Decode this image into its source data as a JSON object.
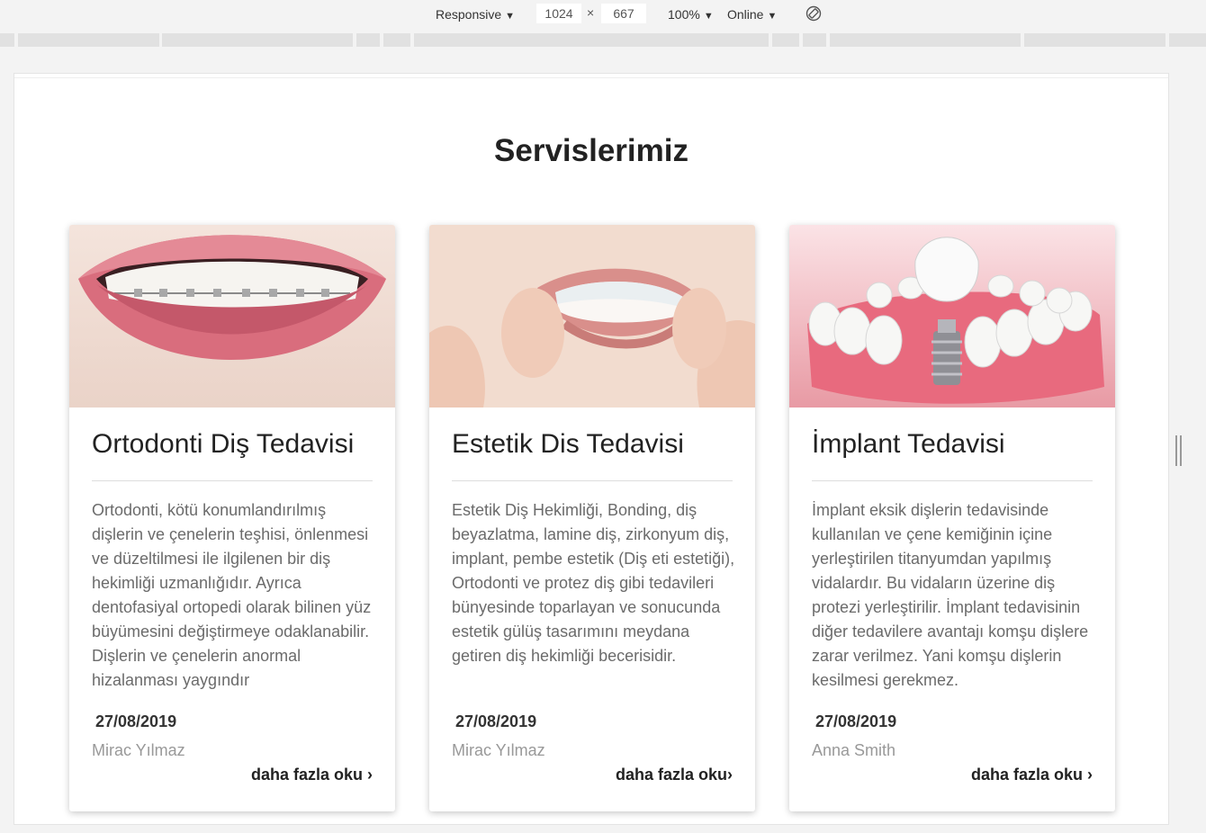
{
  "devtools": {
    "device_select": "Responsive",
    "width_value": "1024",
    "height_value": "667",
    "times_sign": "×",
    "zoom_select": "100%",
    "network_select": "Online",
    "caret": "▼",
    "rotate_icon": "rotate-icon"
  },
  "section": {
    "title": "Servislerimiz"
  },
  "cards": [
    {
      "title": "Ortodonti Diş Tedavisi",
      "text": "Ortodonti, kötü konumlandırılmış dişlerin ve çenelerin teşhisi, önlenmesi ve düzeltilmesi ile ilgilenen bir diş hekimliği uzmanlığıdır. Ayrıca dentofasiyal ortopedi olarak bilinen yüz büyümesini değiştirmeye odaklanabilir. Dişlerin ve çenelerin anormal hizalanması yaygındır",
      "date": "27/08/2019",
      "author": "Mirac Yılmaz",
      "more": "daha fazla oku",
      "image": "braces-smile-photo"
    },
    {
      "title": "Estetik Dis Tedavisi",
      "text": "Estetik Diş Hekimliği, Bonding, diş beyazlatma, lamine diş, zirkonyum diş, implant, pembe estetik (Diş eti estetiği), Ortodonti ve protez diş gibi tedavileri bünyesinde toparlayan ve sonucunda estetik gülüş tasarımını meydana getiren diş hekimliği becerisidir.",
      "date": "27/08/2019",
      "author": "Mirac Yılmaz",
      "more": "daha fazla oku",
      "image": "clear-aligner-photo"
    },
    {
      "title": "İmplant Tedavisi",
      "text": "İmplant eksik dişlerin tedavisinde kullanılan ve çene kemiğinin içine yerleştirilen titanyumdan yapılmış vidalardır. Bu vidaların üzerine diş protezi yerleştirilir. İmplant tedavisinin diğer tedavilere avantajı komşu dişlere zarar verilmez. Yani komşu dişlerin kesilmesi gerekmez.",
      "date": "27/08/2019",
      "author": "Anna Smith",
      "more": "daha fazla oku",
      "image": "dental-implant-illustration"
    }
  ],
  "icons": {
    "chevron": "›"
  },
  "colors": {
    "title": "#222222",
    "body_text": "#6b6b6b",
    "author": "#999999",
    "devtools_bg": "#f3f3f3"
  }
}
